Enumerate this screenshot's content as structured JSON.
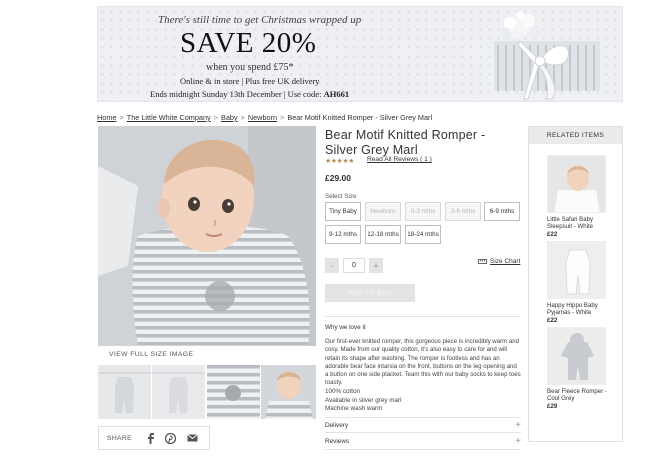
{
  "banner": {
    "line1": "There's still time to get Christmas wrapped up",
    "headline": "SAVE 20%",
    "spend": "when you spend £75*",
    "online": "Online & in store | Plus free UK delivery",
    "ends_prefix": "Ends midnight Sunday 13th December | Use code: ",
    "code": "AH661"
  },
  "breadcrumb": [
    {
      "label": "Home",
      "link": true
    },
    {
      "label": "The Little White Company",
      "link": true
    },
    {
      "label": "Baby",
      "link": true
    },
    {
      "label": "Newborn",
      "link": true
    },
    {
      "label": "Bear Motif Knitted Romper - Silver Grey Marl",
      "link": false
    }
  ],
  "breadcrumb_sep": ">",
  "product": {
    "title": "Bear Motif Knitted Romper - Silver Grey Marl",
    "stars": "★★★★★",
    "rating": 5,
    "reviews_link": "Read All Reviews ( 1 )",
    "price": "£29.00",
    "select_size_label": "Select Size",
    "sizes": [
      {
        "label": "Tiny Baby",
        "available": true
      },
      {
        "label": "Newborn",
        "available": false
      },
      {
        "label": "0-3 mths",
        "available": false
      },
      {
        "label": "3-6 mths",
        "available": false
      },
      {
        "label": "6-9 mths",
        "available": true
      },
      {
        "label": "9-12 mths",
        "available": true
      },
      {
        "label": "12-18 mths",
        "available": true
      },
      {
        "label": "18-24 mths",
        "available": true
      }
    ],
    "quantity": "0",
    "qty_minus": "-",
    "qty_plus": "+",
    "size_chart": "Size Chart",
    "add_to_bag": "ADD TO BAG",
    "view_full": "VIEW FULL SIZE IMAGE",
    "share_label": "SHARE",
    "why_label": "Why we love it",
    "description": "Our first-ever knitted romper, this gorgeous piece is incredibly warm and cosy. Made from our quality cotton, it's also easy to care for and will retain its shape after washing. The romper is footless and has an adorable bear face intarsia on the front, buttons on the leg opening and a button on one side placket. Team this with our baby socks to keep toes toasty.",
    "facts": [
      "100% cotton",
      "Available in silver grey marl",
      "Machine wash warm"
    ],
    "accordion": [
      "Delivery",
      "Reviews"
    ]
  },
  "related": {
    "header": "RELATED ITEMS",
    "items": [
      {
        "name": "Little Safari Baby Sleepsuit - White",
        "price": "£22"
      },
      {
        "name": "Happy Hippo Baby Pyjamas - White",
        "price": "£22"
      },
      {
        "name": "Bear Fleece Romper - Cool Grey",
        "price": "£29"
      }
    ]
  },
  "colors": {
    "star": "#b3905e",
    "button_disabled": "#e4e4e4",
    "related_header": "#eaeaea"
  }
}
